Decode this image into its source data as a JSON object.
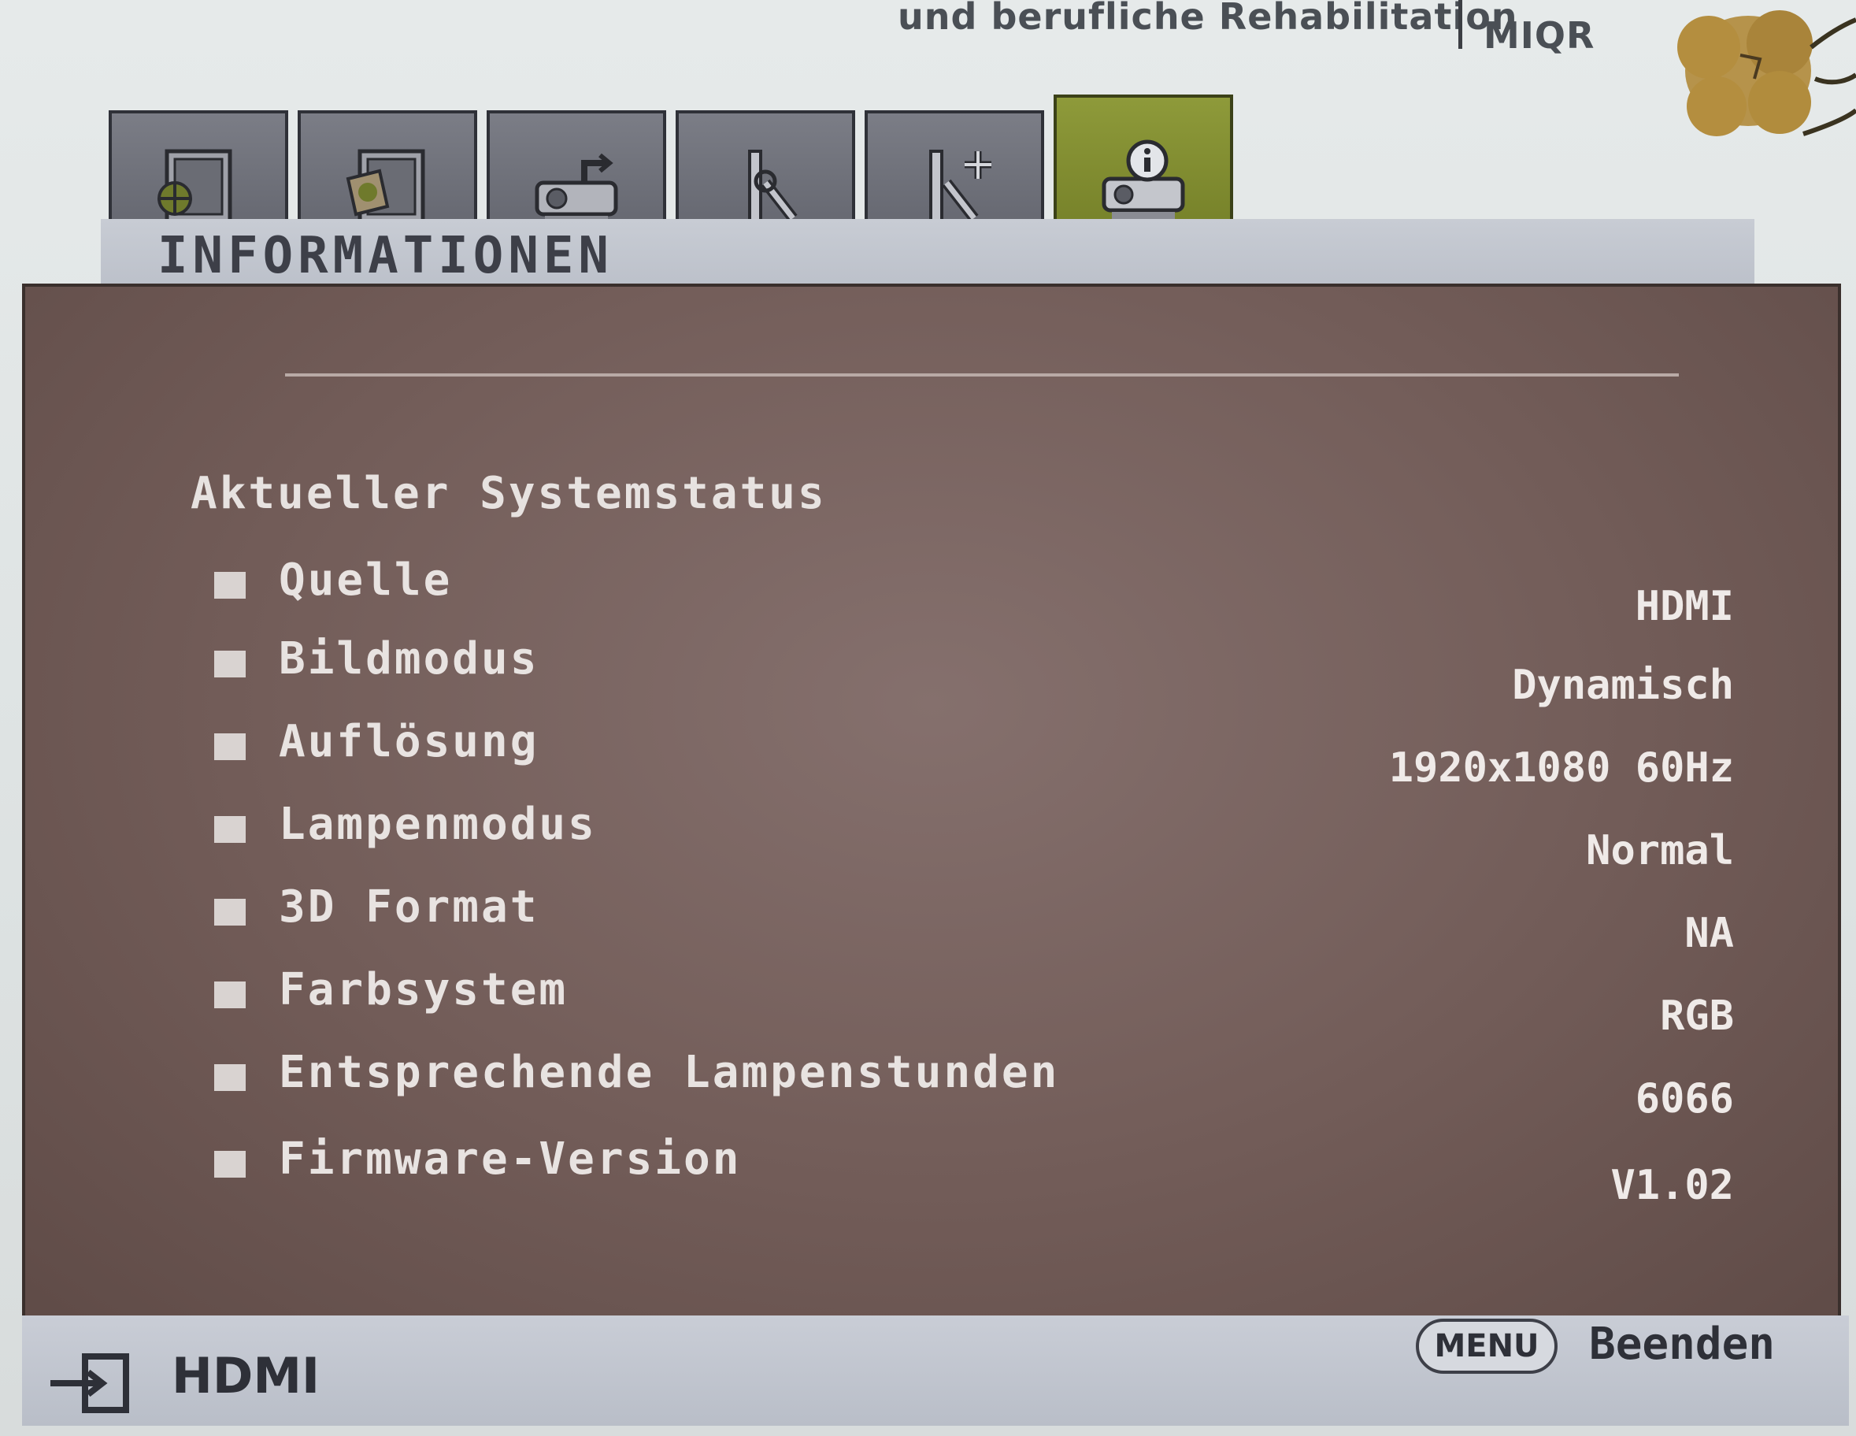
{
  "wall": {
    "left_text": "und berufliche Rehabilitation",
    "right_text": "MIQR"
  },
  "tabs": [
    {
      "icon": "image-settings-icon",
      "active": false
    },
    {
      "icon": "display-settings-icon",
      "active": false
    },
    {
      "icon": "projector-setup-icon",
      "active": false
    },
    {
      "icon": "settings-tools-icon",
      "active": false
    },
    {
      "icon": "advanced-settings-icon",
      "active": false
    },
    {
      "icon": "info-projector-icon",
      "active": true
    }
  ],
  "page": {
    "title": "INFORMATIONEN",
    "section_title": "Aktueller Systemstatus"
  },
  "rows": [
    {
      "label": "Quelle",
      "value": "HDMI"
    },
    {
      "label": "Bildmodus",
      "value": "Dynamisch"
    },
    {
      "label": "Auflösung",
      "value": "1920x1080 60Hz"
    },
    {
      "label": "Lampenmodus",
      "value": "Normal"
    },
    {
      "label": "3D Format",
      "value": "NA"
    },
    {
      "label": "Farbsystem",
      "value": "RGB"
    },
    {
      "label": "Entsprechende Lampenstunden",
      "value": "6066"
    },
    {
      "label": "Firmware-Version",
      "value": "V1.02"
    }
  ],
  "footer": {
    "source_icon": "input-source-icon",
    "source": "HDMI",
    "menu_button": "MENU",
    "exit_label": "Beenden"
  },
  "colors": {
    "panel": "#725c58",
    "active_tab": "#8e9a3a",
    "bar": "#c8ccd4"
  }
}
